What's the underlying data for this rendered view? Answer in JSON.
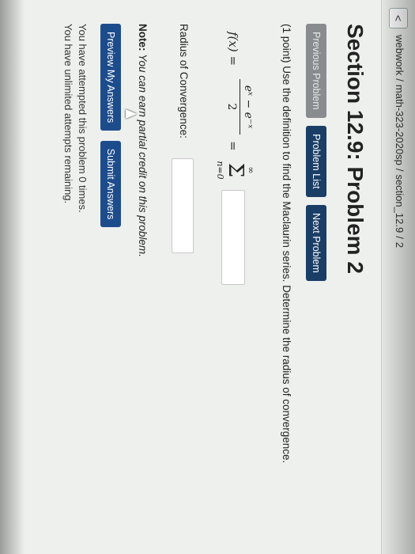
{
  "breadcrumb": {
    "back_label": "<",
    "parts": [
      "webwork",
      "math-323-2020sp",
      "section_12.9",
      "2"
    ],
    "separator": "/"
  },
  "page_title": "Section 12.9: Problem 2",
  "nav": {
    "previous": "Previous Problem",
    "list": "Problem List",
    "next": "Next Problem"
  },
  "question": {
    "text": "(1 point) Use the definition to find the Maclaurin series. Determine the radius of convergence.",
    "fx": "f(x) =",
    "numerator": "eˣ − e⁻ˣ",
    "denominator": "2",
    "equals": "=",
    "sum_upper": "∞",
    "sum_symbol": "Σ",
    "sum_lower": "n=0",
    "series_answer_value": "",
    "radius_label": "Radius of Convergence:",
    "radius_answer_value": ""
  },
  "note": {
    "label": "Note:",
    "text": "You can earn partial credit on this problem."
  },
  "actions": {
    "preview": "Preview My Answers",
    "submit": "Submit Answers"
  },
  "status": {
    "attempts": "You have attempted this problem 0 times.",
    "remaining": "You have unlimited attempts remaining."
  }
}
